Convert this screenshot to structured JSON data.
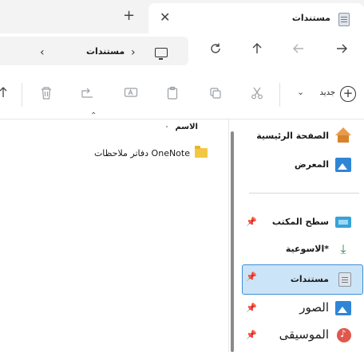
{
  "tab": {
    "title": "مستندات",
    "close_glyph": "✕",
    "new_tab_glyph": "+",
    "icon": "documents-folder-icon"
  },
  "address": {
    "breadcrumb": "مستندات",
    "chevron_left": "‹",
    "chevron_right": "›",
    "icons": [
      "forward-icon",
      "back-icon",
      "up-icon",
      "refresh-icon",
      "monitor-icon"
    ]
  },
  "toolbar": {
    "new_label": "جديد",
    "icons": [
      "new-icon",
      "cut-icon",
      "copy-icon",
      "paste-icon",
      "rename-icon",
      "share-icon",
      "delete-icon",
      "sort-icon"
    ]
  },
  "files": {
    "column_name": "الاسم",
    "items": [
      {
        "name": "دفاتر ملاحظات OneNote",
        "icon": "folder-icon"
      }
    ]
  },
  "sidebar": {
    "items": [
      {
        "label": "الصفحة الرئيسية",
        "icon": "home-icon"
      },
      {
        "label": "المعرض",
        "icon": "gallery-icon"
      },
      {
        "label": "سطح المكتب",
        "icon": "desktop-icon",
        "pinned": true
      },
      {
        "label": "الاسوعية*",
        "icon": "download-icon",
        "pinned": true
      },
      {
        "label": "مستندات",
        "icon": "documents-icon",
        "pinned": true,
        "selected": true
      },
      {
        "label": "الصور",
        "icon": "pictures-icon",
        "pinned": true
      },
      {
        "label": "الموسيقى",
        "icon": "music-icon",
        "pinned": true
      }
    ]
  },
  "colors": {
    "selection_bg": "#cce4f7",
    "selection_border": "#3c8fd8",
    "titlebar_bg": "#f3f3f3"
  }
}
